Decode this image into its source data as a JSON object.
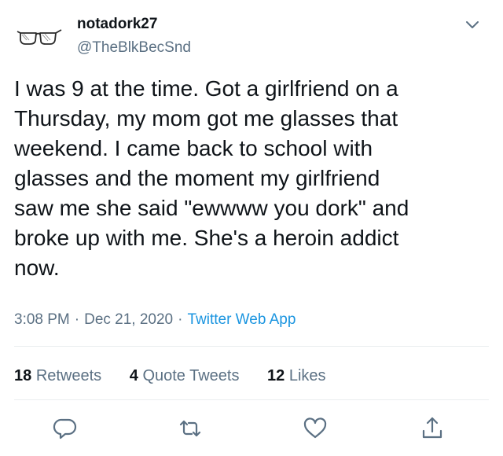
{
  "tweet": {
    "author": {
      "display_name": "notadork27",
      "handle": "@TheBlkBecSnd",
      "avatar_icon": "glasses-icon"
    },
    "text_lines": [
      "I was 9 at the time. Got a girlfriend on a",
      "Thursday, my mom got me glasses that",
      "weekend. I came back to school with",
      "glasses and the moment my girlfriend",
      "saw me she said \"ewwww you dork\" and",
      "broke up with me. She's a heroin addict",
      "now."
    ],
    "time": "3:08 PM",
    "date": "Dec 21, 2020",
    "separator": "·",
    "source": "Twitter Web App",
    "stats": {
      "retweets": {
        "count": "18",
        "label": "Retweets"
      },
      "quote_tweets": {
        "count": "4",
        "label": "Quote Tweets"
      },
      "likes": {
        "count": "12",
        "label": "Likes"
      }
    },
    "actions": [
      "reply-icon",
      "retweet-icon",
      "like-icon",
      "share-icon"
    ]
  },
  "colors": {
    "text": "#0f1419",
    "secondary": "#5b7083",
    "link": "#1b95e0",
    "divider": "#ebeef0"
  }
}
